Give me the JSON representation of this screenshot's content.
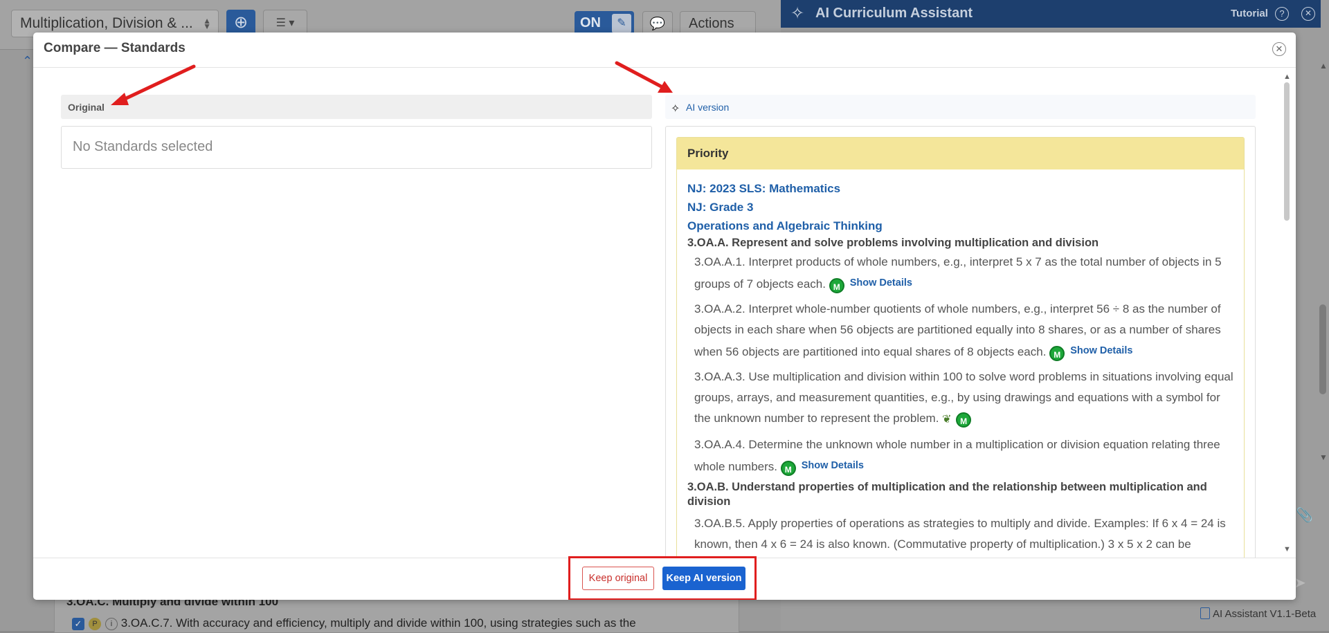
{
  "background": {
    "unit_title": "Multiplication, Division & ...",
    "add_icon": "plus-circle-icon",
    "list_icon": "list-icon",
    "toggle_label": "ON",
    "actions_label": "Actions",
    "bottom_cluster": "3.OA.C. Multiply and divide within 100",
    "bottom_row_badge_p": "P",
    "bottom_row_badge_i": "i",
    "bottom_row_text": "3.OA.C.7. With accuracy and efficiency, multiply and divide within 100, using strategies such as the"
  },
  "assistant": {
    "title": "AI Curriculum Assistant",
    "tutorial_label": "Tutorial",
    "version": "AI Assistant V1.1-Beta"
  },
  "modal": {
    "title": "Compare — Standards",
    "original_label": "Original",
    "original_empty": "No Standards selected",
    "ai_label": "AI version",
    "priority_label": "Priority",
    "links": [
      "NJ: 2023 SLS: Mathematics",
      "NJ: Grade 3",
      "Operations and Algebraic Thinking"
    ],
    "cluster_a": "3.OA.A. Represent and solve problems involving multiplication and division",
    "items_a": [
      {
        "text": "3.OA.A.1. Interpret products of whole numbers, e.g., interpret 5 x 7 as the total number of objects in 5 groups of 7 objects each.",
        "badge": "M",
        "details": "Show Details"
      },
      {
        "text": "3.OA.A.2. Interpret whole-number quotients of whole numbers, e.g., interpret 56 ÷ 8 as the number of objects in each share when 56 objects are partitioned equally into 8 shares, or as a number of shares when 56 objects are partitioned into equal shares of 8 objects each.",
        "badge": "M",
        "details": "Show Details"
      },
      {
        "text": "3.OA.A.3. Use multiplication and division within 100 to solve word problems in situations involving equal groups, arrays, and measurement quantities, e.g., by using drawings and equations with a symbol for the unknown number to represent the problem.",
        "badge": "M",
        "details": ""
      },
      {
        "text": "3.OA.A.4. Determine the unknown whole number in a multiplication or division equation relating three whole numbers.",
        "badge": "M",
        "details": "Show Details"
      }
    ],
    "cluster_b": "3.OA.B. Understand properties of multiplication and the relationship between multiplication and division",
    "item_b5": "3.OA.B.5. Apply properties of operations as strategies to multiply and divide. Examples: If 6 x 4 = 24 is known, then 4 x 6 = 24 is also known. (Commutative property of multiplication.) 3 x 5 x 2 can be",
    "keep_original": "Keep original",
    "keep_ai": "Keep AI version"
  },
  "colors": {
    "primary": "#1a63d0",
    "link": "#1f5fa8",
    "priority_bg": "#f4e69a",
    "badge_green": "#1ea83a",
    "annotation_red": "#e01e1e"
  }
}
